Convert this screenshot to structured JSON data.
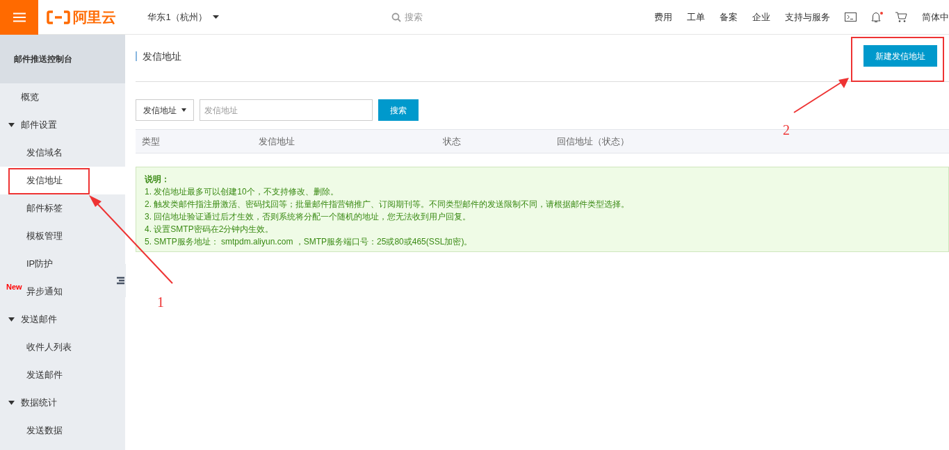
{
  "header": {
    "logo_text": "阿里云",
    "region": "华东1（杭州）",
    "search_placeholder": "搜索",
    "nav": [
      "费用",
      "工单",
      "备案",
      "企业",
      "支持与服务"
    ],
    "notification_dot": true,
    "language": "简体中"
  },
  "sidebar": {
    "title": "邮件推送控制台",
    "items": [
      {
        "kind": "item",
        "label": "概览",
        "selected": false
      },
      {
        "kind": "group",
        "label": "邮件设置",
        "expanded": true,
        "children": [
          {
            "label": "发信域名",
            "selected": false
          },
          {
            "label": "发信地址",
            "selected": true
          },
          {
            "label": "邮件标签",
            "selected": false
          },
          {
            "label": "模板管理",
            "selected": false
          },
          {
            "label": "IP防护",
            "selected": false
          },
          {
            "label": "异步通知",
            "selected": false,
            "badge": "New"
          }
        ]
      },
      {
        "kind": "group",
        "label": "发送邮件",
        "expanded": true,
        "children": [
          {
            "label": "收件人列表",
            "selected": false
          },
          {
            "label": "发送邮件",
            "selected": false
          }
        ]
      },
      {
        "kind": "group",
        "label": "数据统计",
        "expanded": true,
        "children": [
          {
            "label": "发送数据",
            "selected": false
          }
        ]
      }
    ]
  },
  "main": {
    "title": "发信地址",
    "create_button": "新建发信地址",
    "filter": {
      "select": "发信地址",
      "placeholder": "发信地址",
      "button": "搜索"
    },
    "table": {
      "columns": [
        "类型",
        "发信地址",
        "状态",
        "回信地址（状态）"
      ]
    },
    "notice": {
      "heading": "说明：",
      "lines": [
        "1. 发信地址最多可以创建10个，不支持修改、删除。",
        "2. 触发类邮件指注册激活、密码找回等；批量邮件指营销推广、订阅期刊等。不同类型邮件的发送限制不同，请根据邮件类型选择。",
        "3. 回信地址验证通过后才生效，否则系统将分配一个随机的地址，您无法收到用户回复。",
        "4. 设置SMTP密码在2分钟内生效。",
        "5. SMTP服务地址： smtpdm.aliyun.com ，SMTP服务端口号：25或80或465(SSL加密)。"
      ]
    }
  },
  "annotations": [
    {
      "label": "1"
    },
    {
      "label": "2"
    }
  ]
}
